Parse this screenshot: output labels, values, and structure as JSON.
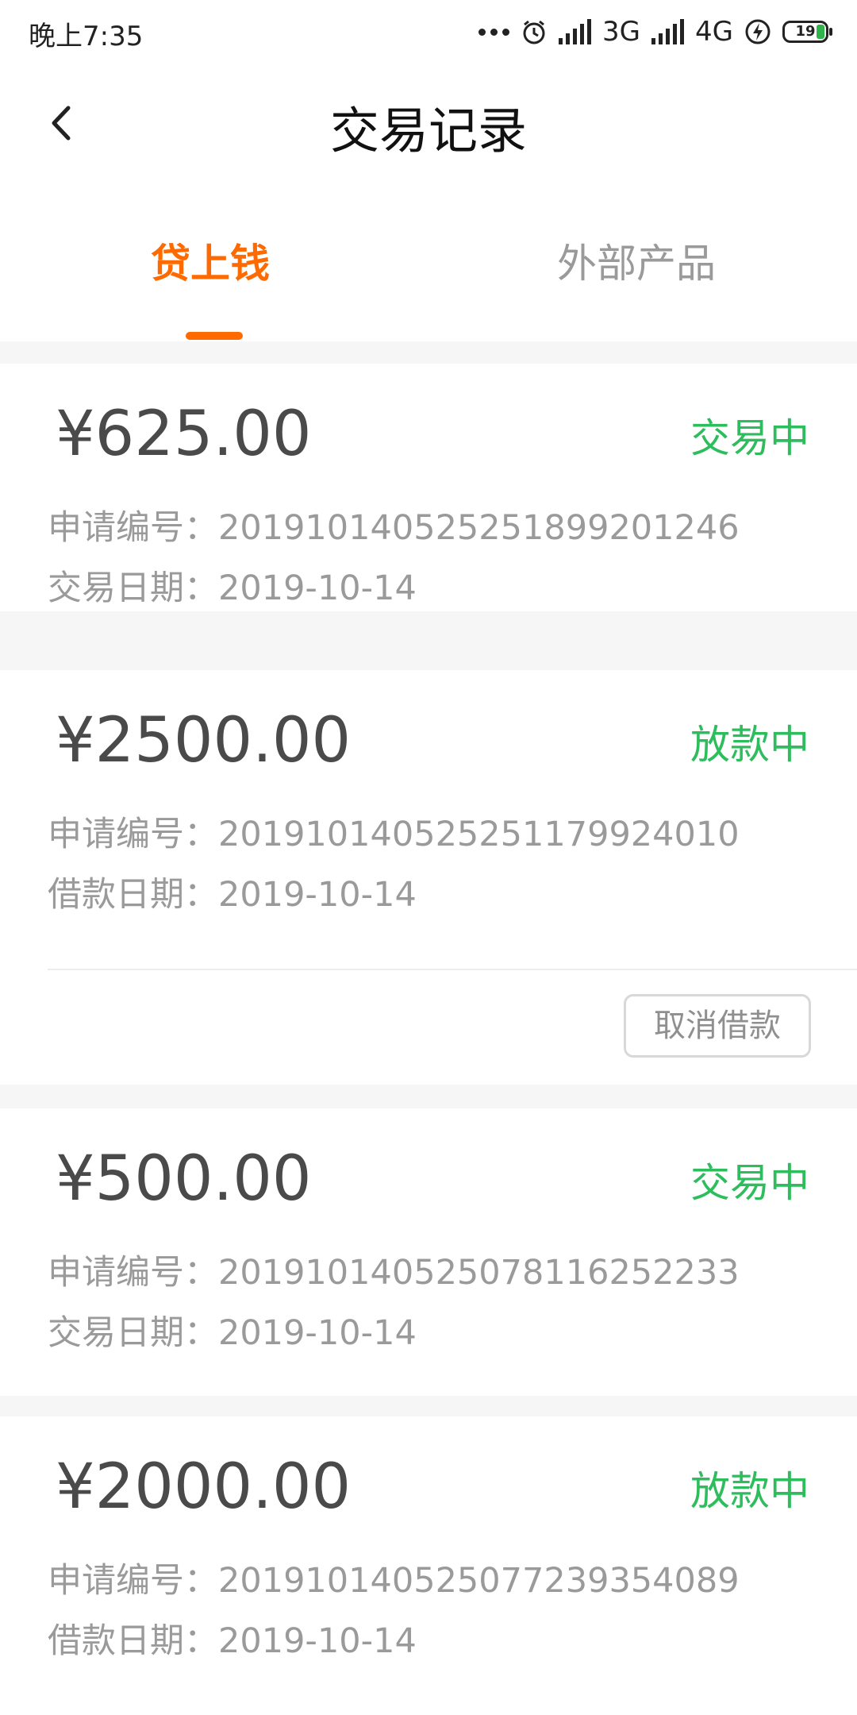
{
  "status_bar": {
    "time": "晚上7:35",
    "net1": "3G",
    "net2": "4G",
    "battery": "19"
  },
  "header": {
    "title": "交易记录"
  },
  "tabs": [
    {
      "label": "贷上钱",
      "active": true
    },
    {
      "label": "外部产品",
      "active": false
    }
  ],
  "records": [
    {
      "amount": "¥625.00",
      "status": "交易中",
      "apply_label": "申请编号：",
      "apply_no": "20191014052525189920​1246",
      "date_label": "交易日期：",
      "date": "2019-10-14"
    },
    {
      "amount": "¥2500.00",
      "status": "放款中",
      "apply_label": "申请编号：",
      "apply_no": "20191014052525117992​4010",
      "date_label": "借款日期：",
      "date": "2019-10-14",
      "action": "取消借款"
    },
    {
      "amount": "¥500.00",
      "status": "交易中",
      "apply_label": "申请编号：",
      "apply_no": "20191014052507811625​2233",
      "date_label": "交易日期：",
      "date": "2019-10-14"
    },
    {
      "amount": "¥2000.00",
      "status": "放款中",
      "apply_label": "申请编号：",
      "apply_no": "20191014052507723935​4089",
      "date_label": "借款日期：",
      "date": "2019-10-14"
    }
  ],
  "colors": {
    "accent": "#ff6a00",
    "status_green": "#2ebd5d"
  }
}
